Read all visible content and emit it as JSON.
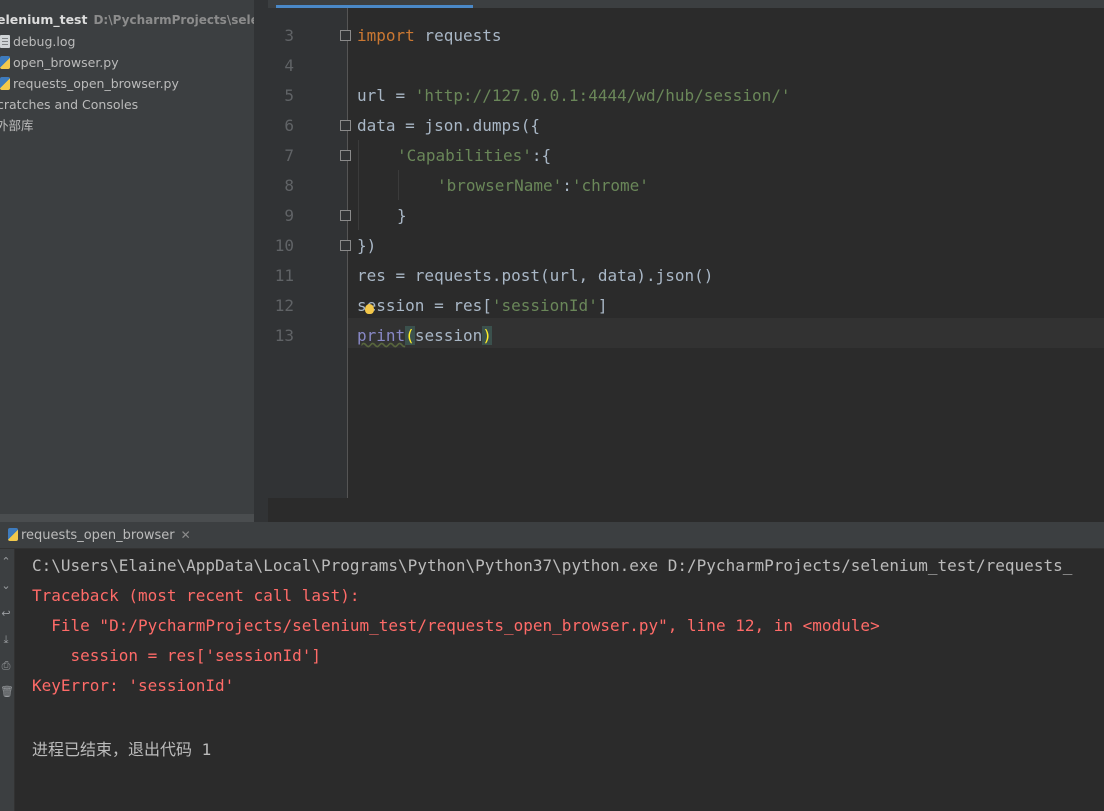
{
  "project": {
    "root": {
      "name": "elenium_test",
      "path": "D:\\PycharmProjects\\selenium_te"
    },
    "items": [
      {
        "label": "debug.log",
        "icon": "log-file-icon"
      },
      {
        "label": "open_browser.py",
        "icon": "python-file-icon"
      },
      {
        "label": "requests_open_browser.py",
        "icon": "python-file-icon"
      },
      {
        "label": "cratches and Consoles"
      },
      {
        "label": "外部库"
      }
    ]
  },
  "editor": {
    "line_numbers": [
      "3",
      "4",
      "5",
      "6",
      "7",
      "8",
      "9",
      "10",
      "11",
      "12",
      "13"
    ],
    "lines": {
      "l3": {
        "kw": "import",
        "rest": " requests"
      },
      "l5": {
        "a": "url = ",
        "s": "'http://127.0.0.1:4444/wd/hub/session/'"
      },
      "l6": {
        "a": "data = json.dumps({"
      },
      "l7": {
        "s": "'Capabilities'",
        "b": ":{"
      },
      "l8": {
        "s1": "'browserName'",
        "b": ":",
        "s2": "'chrome'"
      },
      "l9": {
        "a": "}"
      },
      "l10": {
        "a": "})"
      },
      "l11": {
        "a": "res = requests.post(url, data).json()"
      },
      "l12": {
        "a": "session = res[",
        "s": "'sessionId'",
        "b": "]"
      },
      "l13": {
        "fn": "print",
        "open": "(",
        "arg": "session",
        "close": ")"
      }
    }
  },
  "run": {
    "tab_label": "requests_open_browser",
    "output": {
      "cmd": "C:\\Users\\Elaine\\AppData\\Local\\Programs\\Python\\Python37\\python.exe D:/PycharmProjects/selenium_test/requests_",
      "traceback": "Traceback (most recent call last):",
      "file_prefix": "  File \"",
      "file_link": "D:/PycharmProjects/selenium_test/requests_open_browser.py",
      "file_suffix": "\", line 12, in <module>",
      "code": "    session = res['sessionId']",
      "error": "KeyError: 'sessionId'",
      "exit": "进程已结束，退出代码 1"
    }
  }
}
